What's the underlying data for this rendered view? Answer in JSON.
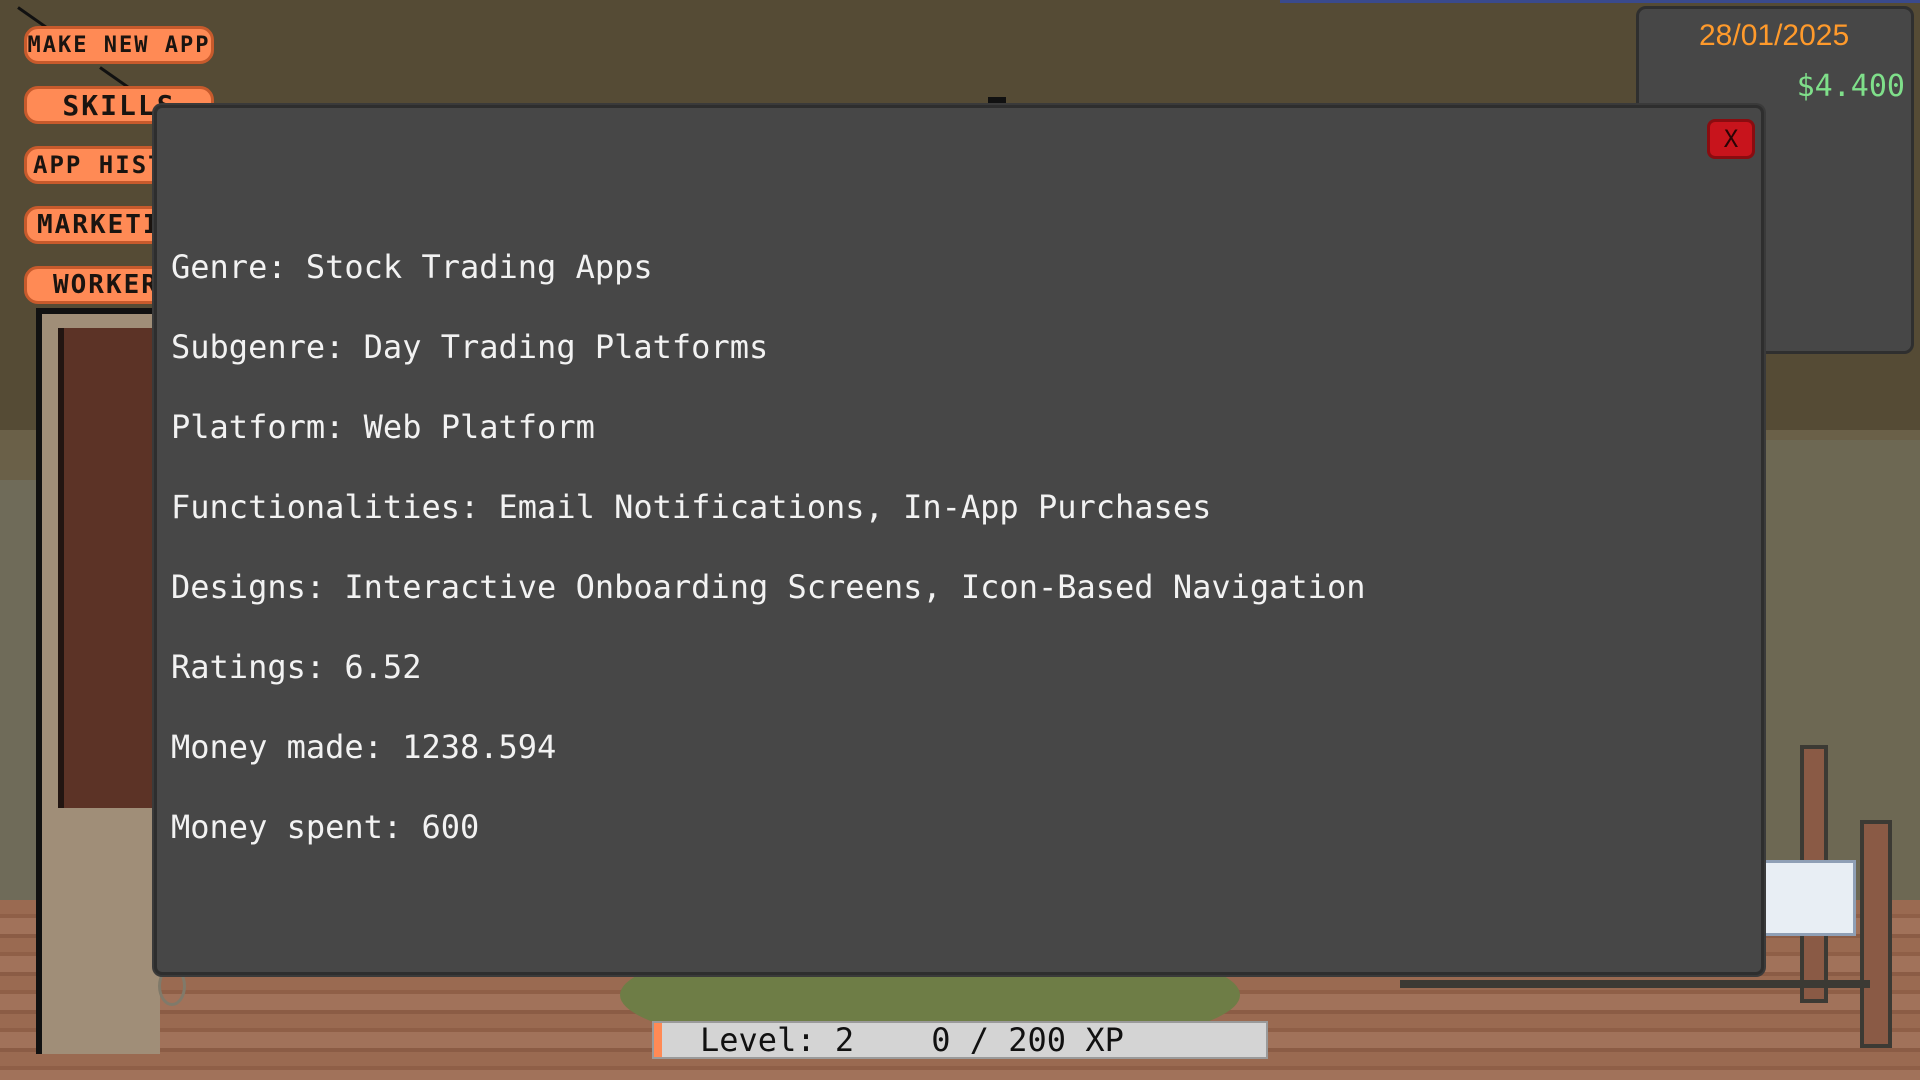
{
  "menu": {
    "make_new_app": "MAKE NEW APP",
    "skills": "SKILLS",
    "app_history": "APP HIST",
    "marketing": "MARKETI",
    "workers": "WORKER"
  },
  "stats": {
    "date": "28/01/2025",
    "money": "$4.400"
  },
  "modal": {
    "close_label": "X",
    "lines": [
      "Genre: Stock Trading Apps",
      "Subgenre: Day Trading Platforms",
      "Platform: Web Platform",
      "Functionalities: Email Notifications, In-App Purchases",
      "Designs: Interactive Onboarding Screens, Icon-Based Navigation",
      "Ratings: 6.52",
      "Money made: 1238.594",
      "Money spent: 600"
    ]
  },
  "level": {
    "text": "Level: 2    0 / 200 XP",
    "xp_fraction": 0
  },
  "colors": {
    "menu_button": "#ff8a55",
    "date": "#ff9a2b",
    "money": "#7fdf8a",
    "close_button": "#c8141c",
    "panel": "#474747"
  }
}
